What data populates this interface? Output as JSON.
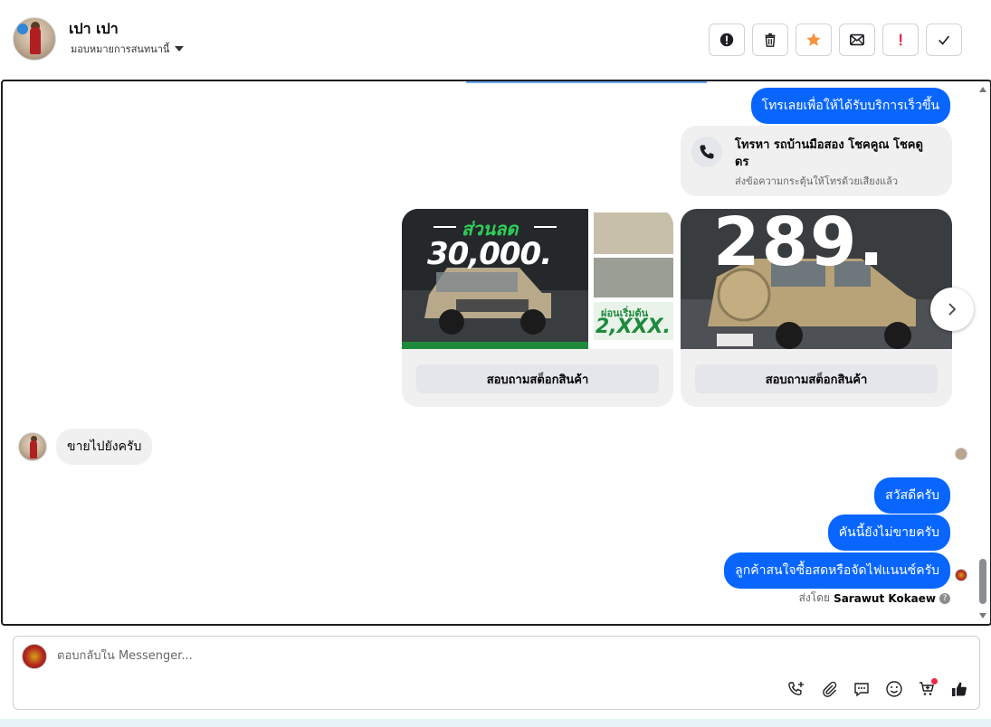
{
  "header": {
    "contact_name": "เปา เปา",
    "assign_label": "มอบหมายการสนทนานี้",
    "actions": [
      {
        "name": "spam-button",
        "icon": "alert-circle-icon"
      },
      {
        "name": "delete-button",
        "icon": "trash-icon"
      },
      {
        "name": "star-button",
        "icon": "star-icon",
        "color": "#f7923b"
      },
      {
        "name": "mark-unread-button",
        "icon": "envelope-icon"
      },
      {
        "name": "follow-up-button",
        "icon": "exclamation-icon",
        "color": "#e41e3f"
      },
      {
        "name": "done-button",
        "icon": "check-icon"
      }
    ]
  },
  "chat": {
    "msg_call_prompt": "โทรเลยเพื่อให้ได้รับบริการเร็วขึ้น",
    "call_card": {
      "title": "โทรหา รถบ้านมือสอง โชคคูณ โชคดูดร",
      "subtitle": "ส่งข้อความกระตุ้นให้โทรด้วยเสียงแล้ว"
    },
    "cards": [
      {
        "banner_title": "ส่วนลด",
        "discount_amount": "30,000.",
        "installment_label": "ผ่อนเริ่มต้น",
        "installment_amount": "2,XXX.",
        "button_label": "สอบถามสต็อกสินค้า"
      },
      {
        "price_text": "289.",
        "button_label": "สอบถามสต็อกสินค้า"
      }
    ],
    "incoming_message": "ขายไปยังครับ",
    "outgoing_messages": [
      "สวัสดีครับ",
      "คันนี้ยังไม่ขายครับ",
      "ลูกค้าสนใจซื้อสดหรือจัดไฟแนนซ์ครับ"
    ],
    "sent_by_prefix": "ส่งโดย",
    "sent_by_name": "Sarawut Kokaew"
  },
  "composer": {
    "placeholder": "ตอบกลับใน Messenger...",
    "tools": [
      "phone-plus-icon",
      "paperclip-icon",
      "chat-bubble-icon",
      "emoji-icon",
      "cart-plus-icon",
      "thumbs-up-icon"
    ]
  },
  "colors": {
    "accent": "#0866ff",
    "bubble_in": "#f0f0f0",
    "star": "#f7923b",
    "alert": "#e41e3f"
  }
}
